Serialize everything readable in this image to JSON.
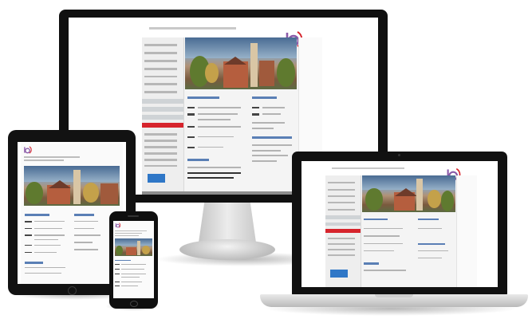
{
  "scene": {
    "devices": [
      "desktop-monitor",
      "tablet",
      "smartphone",
      "laptop"
    ]
  },
  "colors": {
    "bezel": "#111111",
    "stand": "#d6d6d6",
    "accent_red": "#d6242c",
    "link_blue": "#2f77c7",
    "logo_purple": "#8a5aa8"
  }
}
